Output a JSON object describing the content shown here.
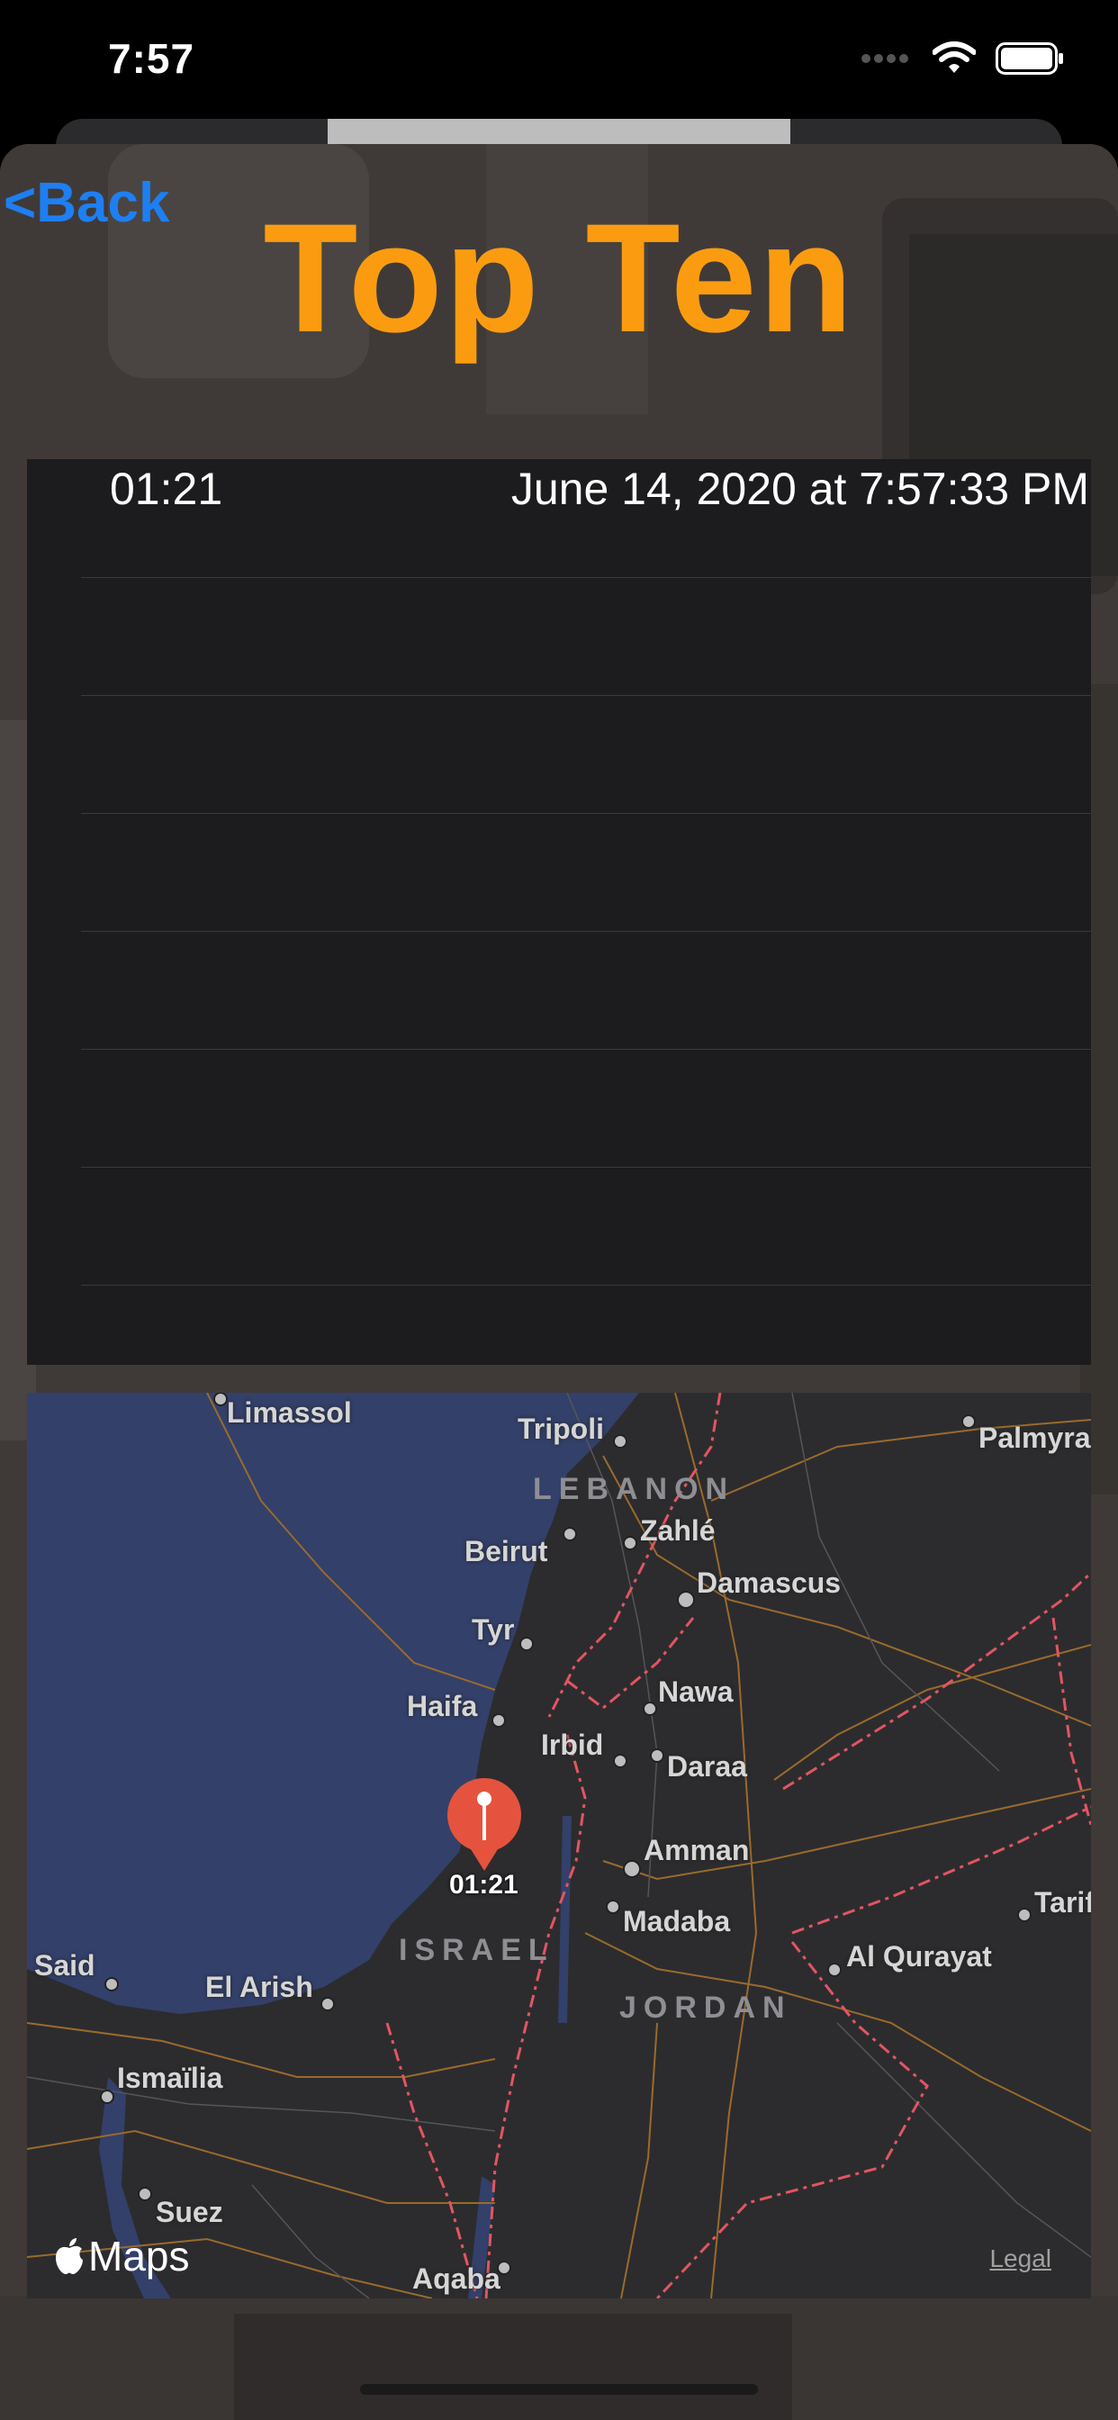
{
  "status_bar": {
    "time": "7:57"
  },
  "nav": {
    "back_label": "<Back",
    "title": "Top Ten"
  },
  "scores": [
    {
      "time": "01:21",
      "date": "June 14, 2020 at 7:57:33 PM"
    },
    {
      "time": "",
      "date": ""
    },
    {
      "time": "",
      "date": ""
    },
    {
      "time": "",
      "date": ""
    },
    {
      "time": "",
      "date": ""
    },
    {
      "time": "",
      "date": ""
    },
    {
      "time": "",
      "date": ""
    }
  ],
  "map": {
    "places": [
      "Limassol",
      "Tripoli",
      "Palmyra",
      "Zahlé",
      "Beirut",
      "Damascus",
      "Tyr",
      "Nawa",
      "Haifa",
      "Irbid",
      "Daraa",
      "Amman",
      "Madaba",
      "Tarif",
      "Said",
      "El Arish",
      "Al Qurayat",
      "Ismaïlia",
      "Suez",
      "Aqaba"
    ],
    "countries": [
      "LEBANON",
      "ISRAEL",
      "JORDAN"
    ],
    "pin_label": "01:21",
    "brand": "Maps",
    "legal": "Legal"
  },
  "colors": {
    "accent": "#fb9c10",
    "link": "#1e7ff2",
    "pin": "#e5533e",
    "sea": "#33406a"
  }
}
